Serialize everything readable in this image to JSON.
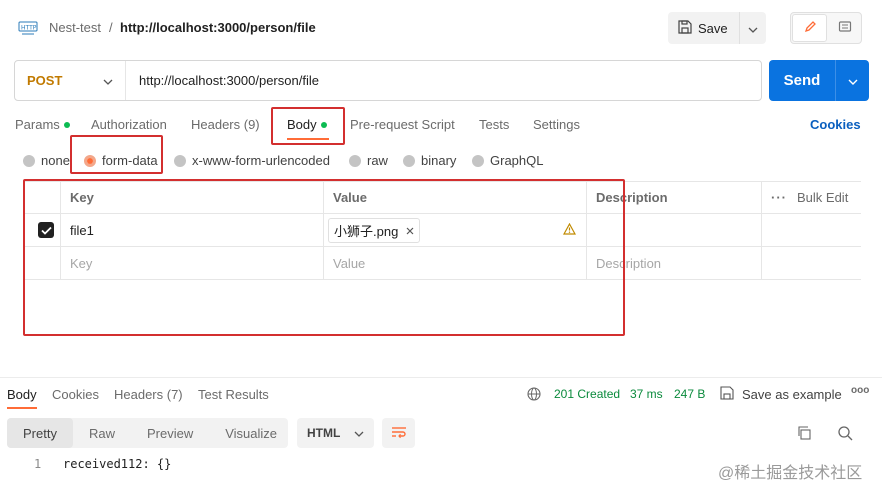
{
  "header": {
    "collection": "Nest-test",
    "separator": "/",
    "request_title": "http://localhost:3000/person/file",
    "save_label": "Save"
  },
  "url_bar": {
    "method": "POST",
    "url": "http://localhost:3000/person/file",
    "send_label": "Send"
  },
  "request_tabs": [
    {
      "label": "Params"
    },
    {
      "label": "Authorization"
    },
    {
      "label": "Headers (9)"
    },
    {
      "label": "Body"
    },
    {
      "label": "Pre-request Script"
    },
    {
      "label": "Tests"
    },
    {
      "label": "Settings"
    }
  ],
  "cookies_label": "Cookies",
  "body_types": [
    {
      "label": "none"
    },
    {
      "label": "form-data"
    },
    {
      "label": "x-www-form-urlencoded"
    },
    {
      "label": "raw"
    },
    {
      "label": "binary"
    },
    {
      "label": "GraphQL"
    }
  ],
  "table": {
    "headers": {
      "key": "Key",
      "value": "Value",
      "description": "Description",
      "bulk_edit": "Bulk Edit"
    },
    "rows": [
      {
        "key": "file1",
        "value": "小狮子.png",
        "description": ""
      }
    ],
    "placeholder": {
      "key": "Key",
      "value": "Value",
      "description": "Description"
    }
  },
  "response": {
    "tabs": [
      {
        "label": "Body"
      },
      {
        "label": "Cookies"
      },
      {
        "label": "Headers (7)"
      },
      {
        "label": "Test Results"
      }
    ],
    "status": "201 Created",
    "time": "37 ms",
    "size": "247 B",
    "save_example": "Save as example",
    "more": "ooo",
    "views": [
      {
        "label": "Pretty"
      },
      {
        "label": "Raw"
      },
      {
        "label": "Preview"
      },
      {
        "label": "Visualize"
      }
    ],
    "language": "HTML",
    "line_number": "1",
    "code": "received112: {}"
  },
  "watermark": "@稀土掘金技术社区",
  "colors": {
    "accent": "#ff6c37",
    "send": "#0a73e0",
    "method": "#c17a00",
    "status_ok": "#0a8a3c",
    "highlight_box": "#d32f2f"
  }
}
